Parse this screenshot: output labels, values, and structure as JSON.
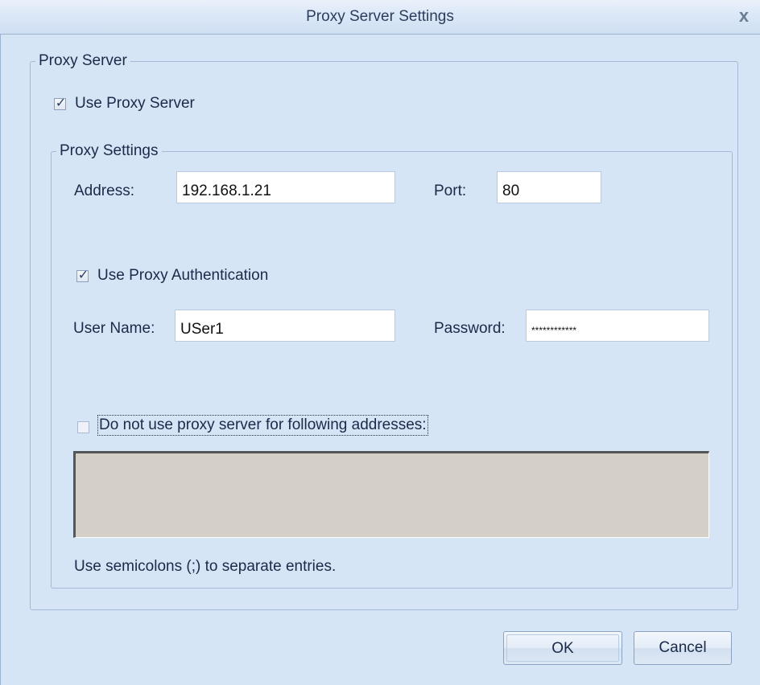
{
  "window": {
    "title": "Proxy Server Settings",
    "close_glyph": "x"
  },
  "proxy_server_group": {
    "legend": "Proxy Server",
    "use_proxy": {
      "label": "Use Proxy Server",
      "checked": true
    }
  },
  "proxy_settings_group": {
    "legend": "Proxy Settings",
    "address": {
      "label": "Address:",
      "value": "192.168.1.21"
    },
    "port": {
      "label": "Port:",
      "value": "80"
    },
    "use_auth": {
      "label": "Use Proxy Authentication",
      "checked": true
    },
    "user_name": {
      "label": "User Name:",
      "value": "USer1"
    },
    "password": {
      "label": "Password:",
      "value": "************"
    },
    "bypass": {
      "label": "Do not use proxy server for following addresses:",
      "checked": false,
      "value": ""
    },
    "hint": "Use semicolons (;) to separate entries."
  },
  "buttons": {
    "ok": "OK",
    "cancel": "Cancel"
  },
  "colors": {
    "dialog_bg": "#d6e5f6",
    "disabled_field_bg": "#d4d0c8"
  }
}
